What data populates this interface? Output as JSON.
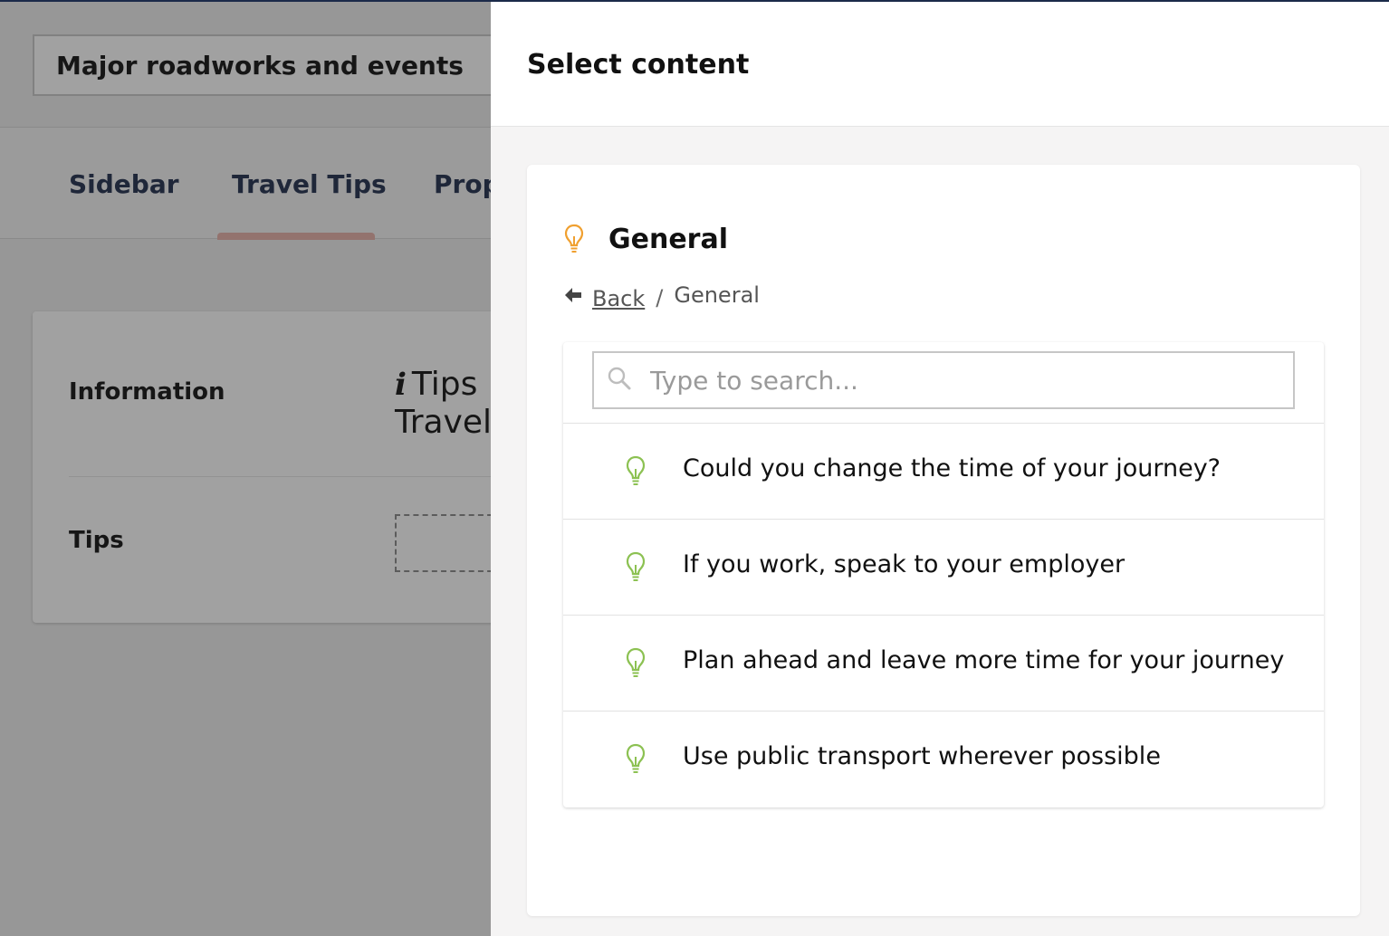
{
  "editor": {
    "name_value": "Major roadworks and events",
    "tabs": [
      {
        "label": "Sidebar"
      },
      {
        "label": "Travel Tips"
      },
      {
        "label": "Prop"
      }
    ],
    "fields": {
      "information_label": "Information",
      "information_value_line1": "Tips",
      "information_value_line2": "Travel",
      "tips_label": "Tips"
    }
  },
  "drawer": {
    "title": "Select content",
    "folder": {
      "title": "General",
      "icon": "lightbulb-icon",
      "icon_color": "#f0a030"
    },
    "breadcrumb": {
      "back_label": "Back",
      "separator": "/",
      "current": "General"
    },
    "search": {
      "placeholder": "Type to search...",
      "value": ""
    },
    "items": [
      {
        "label": "Could you change the time of your journey?",
        "icon": "lightbulb-icon"
      },
      {
        "label": "If you work, speak to your employer",
        "icon": "lightbulb-icon"
      },
      {
        "label": "Plan ahead and leave more time for your journey",
        "icon": "lightbulb-icon"
      },
      {
        "label": "Use public transport wherever possible",
        "icon": "lightbulb-icon"
      }
    ],
    "item_icon_color": "#8cc152"
  },
  "colors": {
    "tab_text": "#1f2d4d",
    "tab_active_underline": "#e7b0a8",
    "overlay": "rgba(30,30,30,0.42)"
  }
}
